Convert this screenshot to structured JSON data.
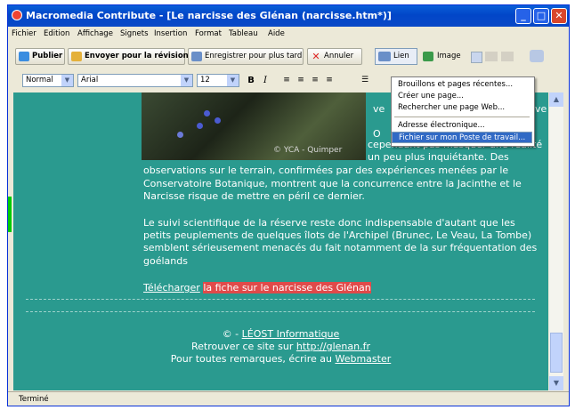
{
  "window": {
    "title": "Macromedia Contribute - [Le narcisse des Glénan (narcisse.htm*)]"
  },
  "menu": [
    "Fichier",
    "Edition",
    "Affichage",
    "Signets",
    "Insertion",
    "Format",
    "Tableau",
    "Aide"
  ],
  "toolbar": {
    "publish": "Publier",
    "send_review": "Envoyer pour la révision",
    "save_later": "Enregistrer pour plus tard",
    "cancel": "Annuler",
    "link": "Lien",
    "image": "Image"
  },
  "format": {
    "style": "Normal",
    "font": "Arial",
    "size": "12",
    "bold": "B",
    "italic": "I"
  },
  "link_menu": {
    "items": [
      "Brouillons et pages récentes...",
      "Créer une page...",
      "Rechercher une page Web...",
      "Adresse électronique...",
      "Fichier sur mon Poste de travail..."
    ],
    "selected": 4
  },
  "content": {
    "photo_credit": "© YCA - Quimper",
    "right_fragments": [
      "ve",
      "uve",
      "O",
      "cependant pas masquer une réalité",
      "un peu plus inquiétante. Des"
    ],
    "para1": [
      "observations sur le terrain, confirmées par des expériences menées par le",
      "Conservatoire Botanique, montrent que la concurrence entre la Jacinthe et le",
      "Narcisse risque de mettre en péril ce dernier."
    ],
    "para2": [
      "Le suivi scientifique de la réserve reste donc indispensable d'autant que les",
      "petits peuplements de quelques îlots de l'Archipel (Brunec, Le Veau, La Tombe)",
      "semblent sérieusement menacés du fait notamment de la sur fréquentation des",
      "goélands"
    ],
    "download_prefix": "Télécharger",
    "download_link": "la fiche sur le narcisse des Glénan"
  },
  "footer": {
    "line1_prefix": "© - ",
    "line1_link": "LÉOST Informatique",
    "line2_prefix": "Retrouver ce site sur ",
    "line2_link": "http://glenan.fr",
    "line3_prefix": "Pour toutes remarques, écrire au ",
    "line3_link": "Webmaster"
  },
  "status": "Terminé"
}
